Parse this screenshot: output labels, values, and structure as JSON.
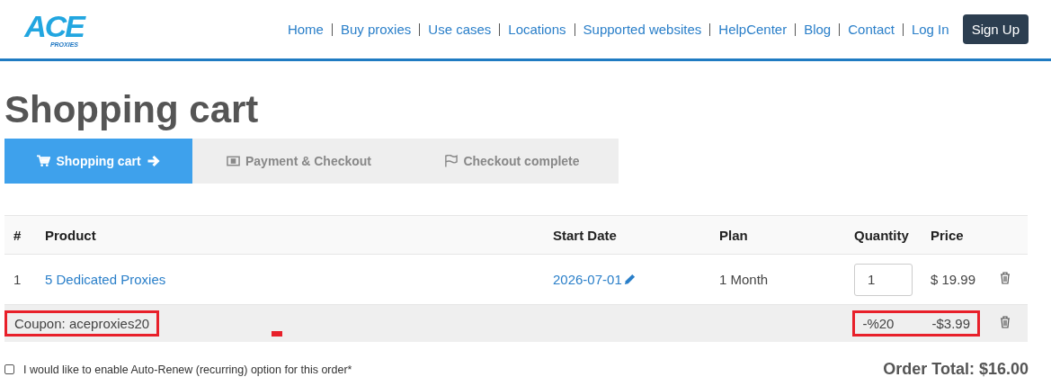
{
  "logo": {
    "mark": "ACE",
    "sub": "PROXIES"
  },
  "nav": {
    "links": [
      "Home",
      "Buy proxies",
      "Use cases",
      "Locations",
      "Supported websites",
      "HelpCenter",
      "Blog",
      "Contact",
      "Log In"
    ],
    "signup": "Sign Up"
  },
  "title": "Shopping cart",
  "steps": [
    {
      "label": "Shopping cart",
      "kind": "cart",
      "selected": true
    },
    {
      "label": "Payment & Checkout",
      "kind": "payment",
      "selected": false
    },
    {
      "label": "Checkout complete",
      "kind": "complete",
      "selected": false
    }
  ],
  "table": {
    "columns": [
      "#",
      "Product",
      "Start Date",
      "Plan",
      "Quantity",
      "Price"
    ],
    "rows": [
      {
        "index": "1",
        "product": "5 Dedicated Proxies",
        "start_date": "2026-07-01",
        "plan": "1 Month",
        "quantity": "1",
        "price": "$ 19.99"
      }
    ],
    "coupon": {
      "label": "Coupon: aceproxies20",
      "percent": "-%20",
      "amount": "-$3.99",
      "highlighted": true
    }
  },
  "auto_renew": {
    "label": "I would like to enable Auto-Renew (recurring) option for this order*",
    "checked": false
  },
  "order_total": "Order Total: $16.00"
}
